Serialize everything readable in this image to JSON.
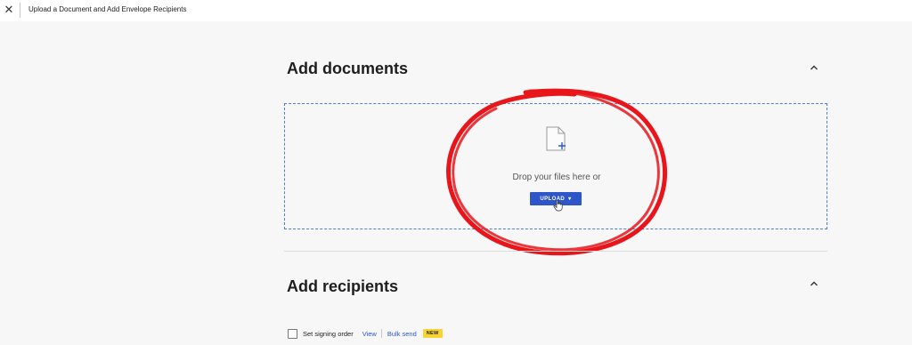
{
  "topbar": {
    "close_icon": "close-icon",
    "title": "Upload a Document and Add Envelope Recipients"
  },
  "documents_section": {
    "title": "Add documents",
    "collapse_icon": "chevron-up-icon",
    "dropzone": {
      "icon": "document-add-icon",
      "prompt": "Drop your files here or",
      "upload_label": "UPLOAD",
      "upload_caret": "▾"
    }
  },
  "recipients_section": {
    "title": "Add recipients",
    "collapse_icon": "chevron-up-icon",
    "signing_order_label": "Set signing order",
    "view_link": "View",
    "bulk_send_link": "Bulk send",
    "new_badge": "NEW"
  },
  "colors": {
    "accent": "#2e56c9",
    "annotation": "#e8151b",
    "badge": "#f8d433",
    "dropzone_border": "#4a7ed8"
  }
}
